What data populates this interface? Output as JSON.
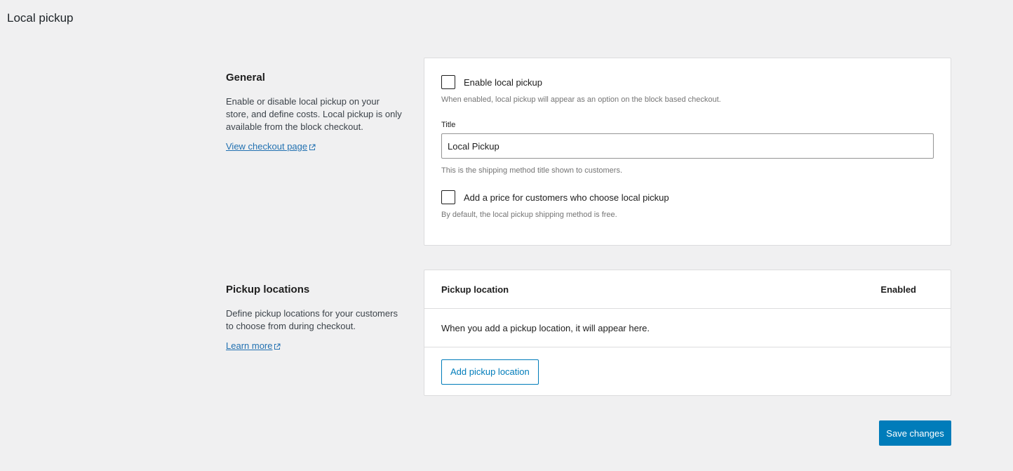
{
  "page": {
    "title": "Local pickup"
  },
  "general": {
    "heading": "General",
    "description": "Enable or disable local pickup on your store, and define costs. Local pickup is only available from the block checkout.",
    "link_label": "View checkout page",
    "enable_label": "Enable local pickup",
    "enable_help": "When enabled, local pickup will appear as an option on the block based checkout.",
    "title_label": "Title",
    "title_value": "Local Pickup",
    "title_help": "This is the shipping method title shown to customers.",
    "price_label": "Add a price for customers who choose local pickup",
    "price_help": "By default, the local pickup shipping method is free."
  },
  "locations": {
    "heading": "Pickup locations",
    "description": "Define pickup locations for your customers to choose from during checkout.",
    "link_label": "Learn more",
    "col_location": "Pickup location",
    "col_enabled": "Enabled",
    "empty_text": "When you add a pickup location, it will appear here.",
    "add_button": "Add pickup location"
  },
  "actions": {
    "save_label": "Save changes"
  },
  "icons": {
    "external": "external-link-icon"
  },
  "colors": {
    "accent": "#007cba",
    "link": "#2271b1",
    "background": "#f0f0f1"
  }
}
